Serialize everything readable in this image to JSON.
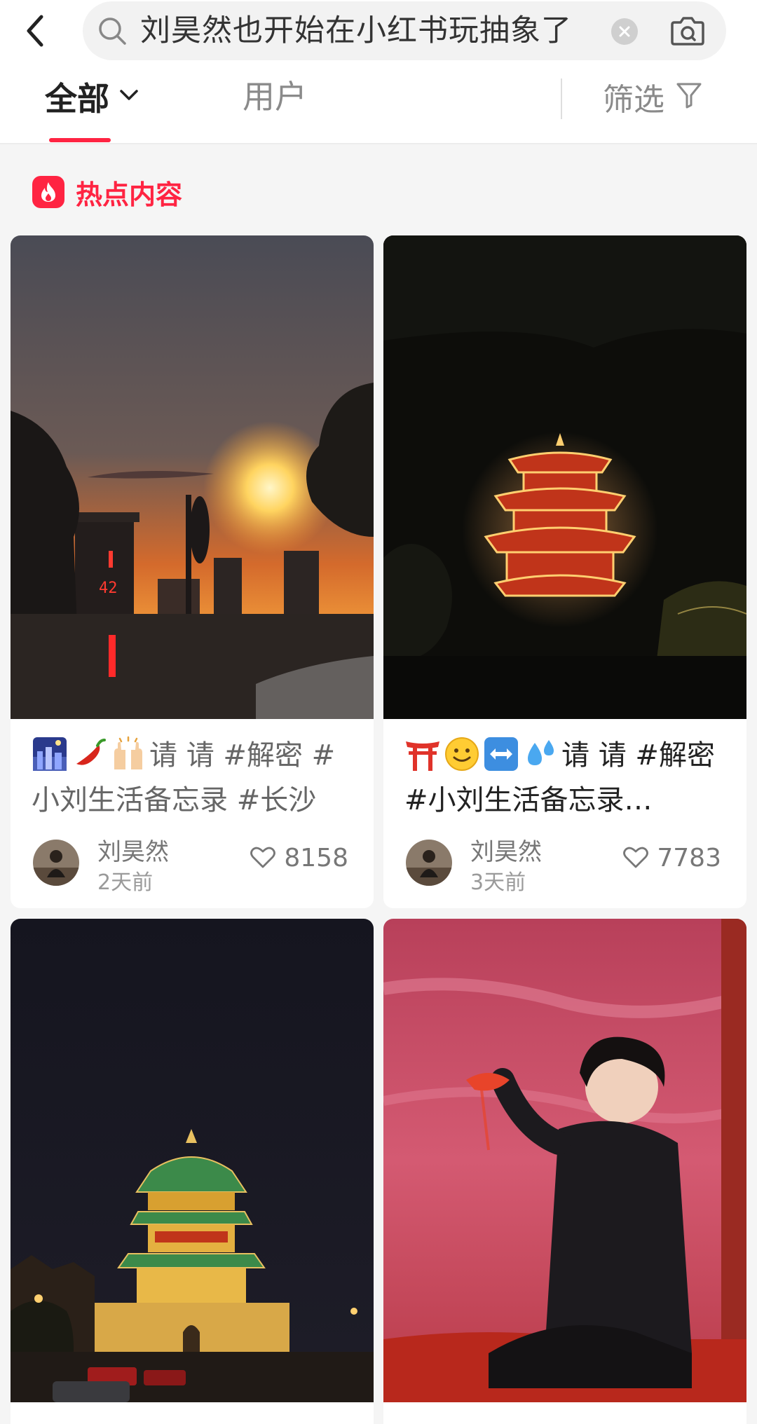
{
  "search": {
    "query": "刘昊然也开始在小红书玩抽象了"
  },
  "tabs": {
    "all_label": "全部",
    "users_label": "用户",
    "filter_label": "筛选"
  },
  "section": {
    "title": "热点内容"
  },
  "colors": {
    "brand": "#ff2442",
    "text_secondary": "#8a8a8a"
  },
  "cards": [
    {
      "title_text": "请 请 #解密 #小刘生活备忘录 #长沙",
      "emojis": [
        "night-cityscape-emoji",
        "chili-pepper-emoji",
        "raising-hands-emoji"
      ],
      "author": "刘昊然",
      "time": "2天前",
      "likes": "8158",
      "image": "sunset-street-photo"
    },
    {
      "title_text": "请 请 #解密 #小刘生活备忘录…",
      "emojis": [
        "torii-gate-emoji",
        "smiling-face-emoji",
        "left-right-arrow-emoji",
        "sweat-droplets-emoji"
      ],
      "author": "刘昊然",
      "time": "3天前",
      "likes": "7783",
      "image": "night-pavilion-photo"
    },
    {
      "image": "bell-tower-night-photo"
    },
    {
      "image": "man-on-red-sand-photo"
    }
  ]
}
